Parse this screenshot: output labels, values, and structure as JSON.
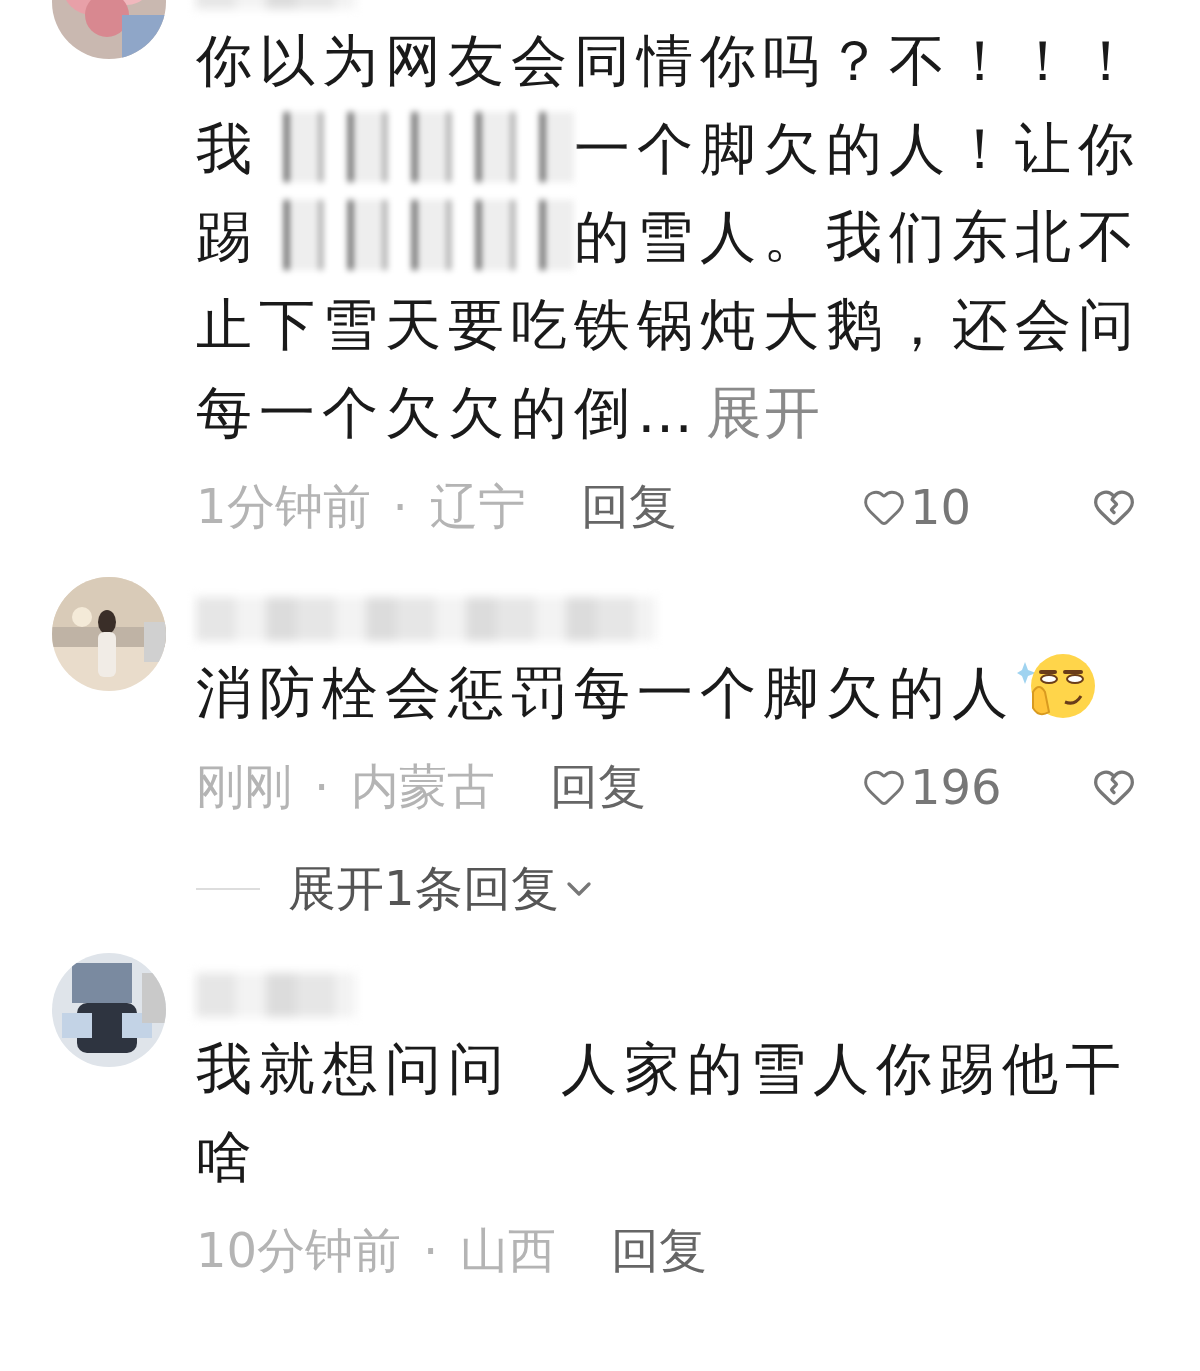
{
  "comments": [
    {
      "avatar": {
        "kind": "picture"
      },
      "body": [
        {
          "kind": "text",
          "text": "你以为网友会同情你吗？不！！！我"
        },
        {
          "kind": "redacted"
        },
        {
          "kind": "text",
          "text": "一个脚欠的人！让你踢"
        },
        {
          "kind": "redacted"
        },
        {
          "kind": "text",
          "text": "的雪人。我们东北不止下雪天要吃铁锅炖大鹅，还会问每一个欠欠的倒…"
        }
      ],
      "expand_link": "展开",
      "time": "1分钟前",
      "separator": "·",
      "location": "辽宁",
      "reply": "回复",
      "likes": "10"
    },
    {
      "avatar": {
        "kind": "picture"
      },
      "body": [
        {
          "kind": "text",
          "text": "消防栓会惩罚每一个脚欠的人"
        },
        {
          "kind": "emoji"
        }
      ],
      "time": "刚刚",
      "separator": "·",
      "location": "内蒙古",
      "reply": "回复",
      "likes": "196",
      "replies_toggle": "展开1条回复"
    },
    {
      "avatar": {
        "kind": "picture"
      },
      "body": [
        {
          "kind": "text",
          "text": "我就想问问  人家的雪人你踢他干啥"
        }
      ],
      "time": "10分钟前",
      "separator": "·",
      "location": "山西",
      "reply": "回复"
    }
  ]
}
